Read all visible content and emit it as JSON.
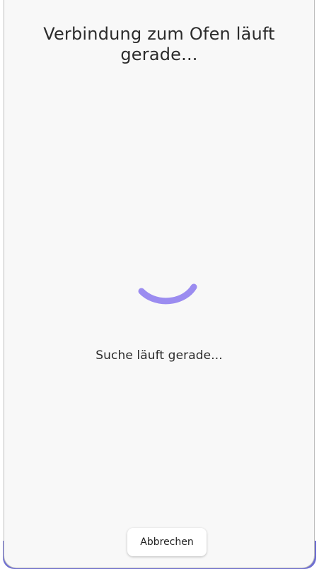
{
  "dialog": {
    "title": "Verbindung zum Ofen läuft gerade...",
    "status_text": "Suche läuft gerade...",
    "cancel_label": "Abbrechen"
  },
  "icons": {
    "loading": "loading-spinner-icon"
  },
  "colors": {
    "background": "#f8f8f8",
    "spinner": "#9b8cf0",
    "accent_edge": "#6f6fd1",
    "text": "#2b2b2b"
  }
}
